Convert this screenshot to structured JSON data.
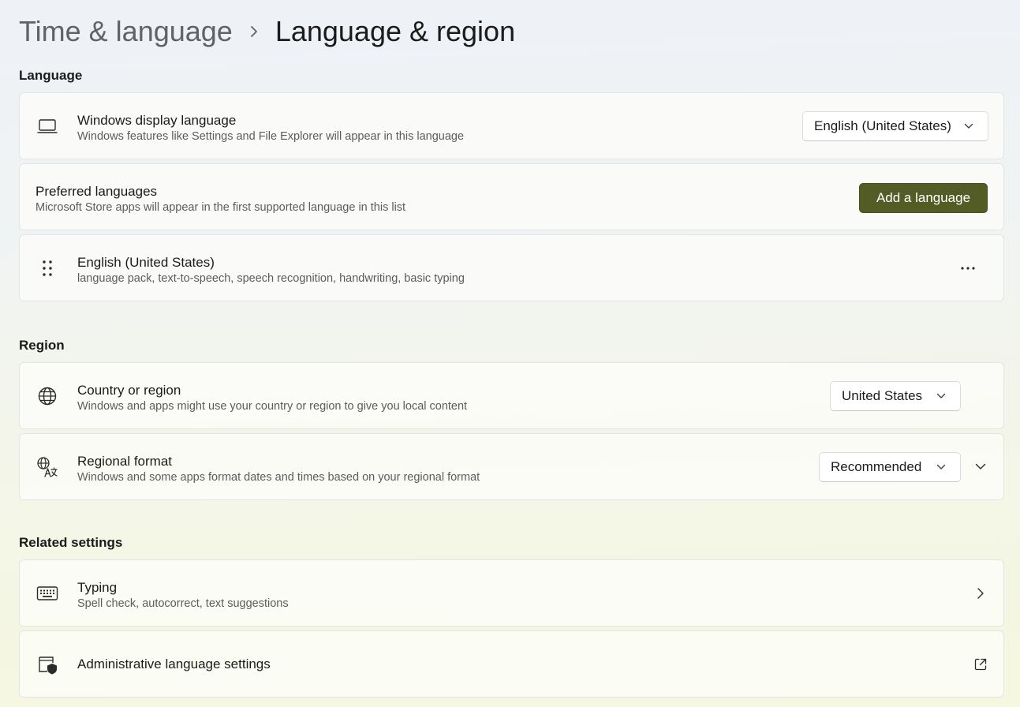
{
  "breadcrumb": {
    "parent": "Time & language",
    "current": "Language & region"
  },
  "sections": {
    "language": "Language",
    "region": "Region",
    "related": "Related settings"
  },
  "display_language": {
    "icon": "laptop-icon",
    "title": "Windows display language",
    "description": "Windows features like Settings and File Explorer will appear in this language",
    "selected": "English (United States)"
  },
  "preferred_languages": {
    "title": "Preferred languages",
    "description": "Microsoft Store apps will appear in the first supported language in this list",
    "button_label": "Add a language"
  },
  "language_item": {
    "icon": "drag-handle-icon",
    "title": "English (United States)",
    "description": "language pack, text-to-speech, speech recognition, handwriting, basic typing",
    "more_icon": "more-options-icon"
  },
  "country_region": {
    "icon": "globe-icon",
    "title": "Country or region",
    "description": "Windows and apps might use your country or region to give you local content",
    "selected": "United States"
  },
  "regional_format": {
    "icon": "language-format-icon",
    "title": "Regional format",
    "description": "Windows and some apps format dates and times based on your regional format",
    "selected": "Recommended"
  },
  "typing": {
    "icon": "keyboard-icon",
    "title": "Typing",
    "description": "Spell check, autocorrect, text suggestions"
  },
  "admin_language": {
    "icon": "admin-shield-icon",
    "title": "Administrative language settings",
    "action_icon": "open-external-icon"
  },
  "colors": {
    "accent": "#545c26",
    "text_primary": "#1b1b1b",
    "text_secondary": "#5c5c5c"
  }
}
